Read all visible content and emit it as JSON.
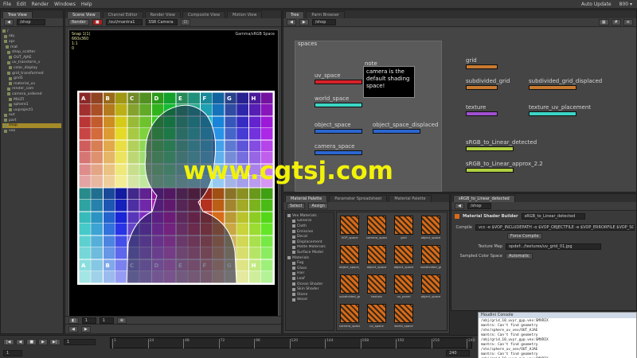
{
  "menu": {
    "items": [
      "File",
      "Edit",
      "Render",
      "Windows",
      "Help"
    ],
    "right": [
      "Auto Update",
      "800 ▾"
    ]
  },
  "left_panel": {
    "tab": "Tree View",
    "path": "/shop",
    "tree": [
      {
        "label": "/",
        "sel": false
      },
      {
        "label": "obj",
        "sel": false
      },
      {
        "label": "xpr",
        "sel": false
      },
      {
        "label": "mat",
        "sel": false
      },
      {
        "label": "shop_scatter",
        "sel": false
      },
      {
        "label": "OUT_AJAE",
        "sel": false
      },
      {
        "label": "uv_transform_v",
        "sel": false
      },
      {
        "label": "color_display",
        "sel": false
      },
      {
        "label": "grid_transformed",
        "sel": false
      },
      {
        "label": "grid1",
        "sel": false
      },
      {
        "label": "material_uv",
        "sel": false
      },
      {
        "label": "render_cam",
        "sel": false
      },
      {
        "label": "camera_ordered",
        "sel": false
      },
      {
        "label": "MULTI",
        "sel": false
      },
      {
        "label": "sphere1",
        "sel": false
      },
      {
        "label": "uvproject1",
        "sel": false
      },
      {
        "label": "out",
        "sel": false
      },
      {
        "label": "part",
        "sel": false
      },
      {
        "label": "shop",
        "sel": true
      },
      {
        "label": "vex",
        "sel": false
      }
    ]
  },
  "viewport": {
    "tabs": [
      "Scene View",
      "Channel Editor",
      "Render View",
      "Composite View",
      "Motion View"
    ],
    "toolbar": [
      "Render",
      "/out/mantra1",
      "SSR Camera"
    ],
    "overlay_tl": [
      "Snap 1(1)",
      "660x360",
      "1:1",
      "0"
    ],
    "overlay_tr": "Gamma/sRGB Space",
    "scale_label": "1",
    "scale_value": "1"
  },
  "grid_letters": [
    "A",
    "B",
    "C",
    "D",
    "E",
    "F",
    "G",
    "H",
    "A",
    "B",
    "C",
    "D",
    "E",
    "F",
    "G",
    "H"
  ],
  "network": {
    "tabs": [
      "Tree",
      "Parm Browser"
    ],
    "path": "/shop",
    "group_label": "spaces",
    "note_title": "note",
    "note_text": [
      "camera is the",
      "default shading",
      "space!"
    ],
    "nodes": [
      {
        "label": "uv_space",
        "color": "#d8202a"
      },
      {
        "label": "world_space",
        "color": "#3cd6c6"
      },
      {
        "label": "object_space",
        "color": "#2c66d0"
      },
      {
        "label": "object_space_displaced",
        "color": "#2c66d0"
      },
      {
        "label": "camera_space",
        "color": "#2c66d0"
      }
    ],
    "right_nodes": [
      {
        "label": "grid",
        "color": "#c87a30"
      },
      {
        "label": "subdivided_grid",
        "color": "#c87a30"
      },
      {
        "label": "subdivided_grid_displaced",
        "color": "#c87a30"
      },
      {
        "label": "texture",
        "color": "#a050d0"
      },
      {
        "label": "texture_uv_placement",
        "color": "#3cd6c6"
      },
      {
        "label": "sRGB_to_Linear_detected",
        "color": "#b0d040"
      },
      {
        "label": "sRGB_to_Linear_approx_2.2",
        "color": "#b0d040"
      }
    ]
  },
  "gallery": {
    "tabs": [
      "Material Palette",
      "Parameter Spreadsheet",
      "Material Palette"
    ],
    "buttons": [
      "Select",
      "Assign"
    ],
    "categories": [
      "Vex Materials",
      "General",
      "Cloth",
      "Emissive",
      "Decal",
      "Displacement",
      "Matte Materials",
      "Surface Model",
      "Materials",
      "Fog",
      "Glass",
      "Hair",
      "Leaf",
      "Ocean Shader",
      "Skin Shader",
      "Stone",
      "Wood"
    ],
    "items": [
      "VOP_space",
      "camera_space",
      "grid",
      "object_space",
      "object_space_d",
      "object_space",
      "object_space",
      "subdivided_grid",
      "subdivided_grid",
      "texture",
      "uv_panel",
      "object_space",
      "camera_space",
      "uv_space",
      "world_space"
    ]
  },
  "params": {
    "tabs": [
      "sRGB_to_Linear_detected"
    ],
    "path": "/shop",
    "title": "Material Shader Builder",
    "node_name": "sRGB_to_Linear_detected",
    "rows": [
      {
        "label": "Compile",
        "value": "vcc -e $VOP_INCLUDEPATH -o $VOP_OBJECTFILE -e $VOP_ERRORFILE $VOP_SOU"
      },
      {
        "label": "",
        "value": "Force Compile"
      },
      {
        "label": "Texture Map",
        "value": "opdef:../textures/uv_grid_01.jpg"
      },
      {
        "label": "Sampled Color Space",
        "value": "Automatic"
      }
    ]
  },
  "console": {
    "title": "Houdini Console",
    "lines": [
      "/obj/grid_10_uvyr_gyp.vex:SMXRIX",
      "mantra:  Can't find geometry",
      "/shs/sphere_uv_vex/OUT_AJAE",
      "mantra:  Can't find geometry",
      "/obj/grid_10_uvyr_gyp.vex:SMXRIX",
      "mantra:  Can't find geometry",
      "/shs/sphere_uv_vex/OUT_AJAE",
      "mantra:  Can't find geometry",
      "/obj/grid_10_uvyr_gyp.vex:SMXRIX"
    ]
  },
  "timeline": {
    "frame": "1",
    "start": "1",
    "end": "240",
    "ticks": [
      "1",
      "24",
      "48",
      "72",
      "96",
      "120",
      "144",
      "168",
      "192",
      "216",
      "240"
    ]
  },
  "watermark": "www.cgtsj.com",
  "colors": {
    "accent": "#a58a2a",
    "panel": "#3a3a3a",
    "note": "#000000"
  }
}
